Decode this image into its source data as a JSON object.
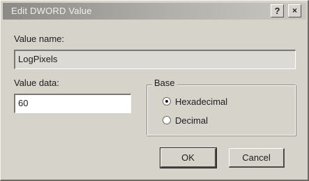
{
  "window": {
    "title": "Edit DWORD Value",
    "help_glyph": "?",
    "close_glyph": "×"
  },
  "value_name": {
    "label": "Value name:",
    "value": "LogPixels"
  },
  "value_data": {
    "label": "Value data:",
    "value": "60"
  },
  "base": {
    "label": "Base",
    "options": [
      {
        "label": "Hexadecimal",
        "selected": true
      },
      {
        "label": "Decimal",
        "selected": false
      }
    ]
  },
  "buttons": {
    "ok": "OK",
    "cancel": "Cancel"
  }
}
